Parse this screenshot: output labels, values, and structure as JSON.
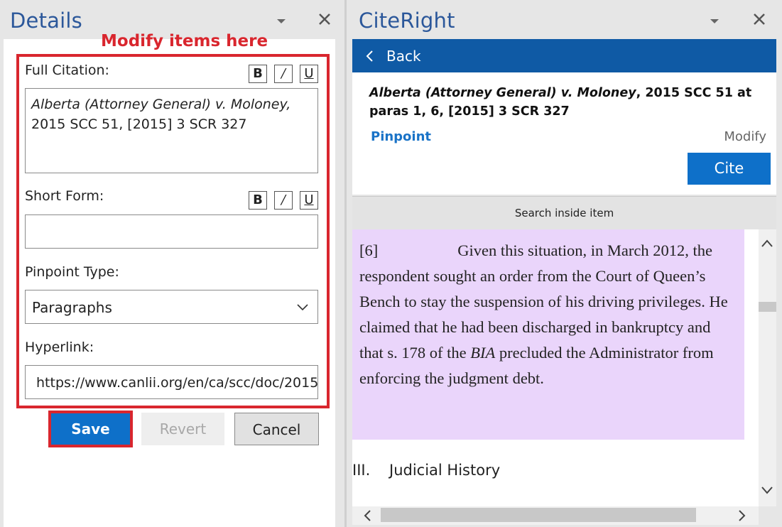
{
  "details_pane": {
    "title": "Details",
    "annotation": "Modify items here",
    "full_citation": {
      "label": "Full Citation:",
      "value_italic": "Alberta (Attorney General) v. Moloney,",
      "value_plain": "2015 SCC 51, [2015] 3 SCR 327"
    },
    "format_buttons": {
      "bold": "B",
      "italic": "/",
      "underline": "U"
    },
    "short_form": {
      "label": "Short Form:",
      "value": ""
    },
    "pinpoint_type": {
      "label": "Pinpoint Type:",
      "value": "Paragraphs"
    },
    "hyperlink": {
      "label": "Hyperlink:",
      "value": "https://www.canlii.org/en/ca/scc/doc/2015/"
    },
    "buttons": {
      "save": "Save",
      "revert": "Revert",
      "cancel": "Cancel"
    }
  },
  "citeright_pane": {
    "title": "CiteRight",
    "back_label": "Back",
    "citation_italic": "Alberta (Attorney General) v. Moloney",
    "citation_plain": ", 2015 SCC 51 at paras 1, 6, [2015] 3 SCR 327",
    "pinpoint_link": "Pinpoint",
    "modify_link": "Modify",
    "cite_button": "Cite",
    "search_label": "Search inside item",
    "document": {
      "para_number": "[6]",
      "para_text_1": "Given this situation, in March 2012, the respondent sought an order from the Court of Queen’s Bench to stay the suspension of his driving privileges.  He claimed that he had been discharged in bankruptcy and that s. 178 of the ",
      "para_italic": "BIA",
      "para_text_2": " precluded the Administrator from enforcing the judgment debt.",
      "heading_number": "III.",
      "heading_text": "Judicial History"
    }
  },
  "icons": [
    "chevron-down-icon",
    "close-icon",
    "chevron-left-icon",
    "chevron-up-icon",
    "chevron-right-icon"
  ],
  "colors": {
    "accent_blue": "#0e70c9",
    "back_bar": "#0f5aa5",
    "title_blue": "#2b579a",
    "annotation_red": "#d9262e",
    "highlight": "#ead5fb",
    "link_blue": "#1a73c7"
  }
}
